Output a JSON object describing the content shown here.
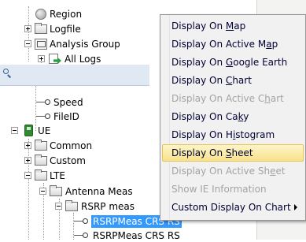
{
  "tree": {
    "region": {
      "label": "Region"
    },
    "logfile": {
      "label": "Logfile"
    },
    "analysis_group": {
      "label": "Analysis Group"
    },
    "all_logs": {
      "label": "All Logs"
    },
    "speed": {
      "label": "Speed"
    },
    "fileid": {
      "label": "FileID"
    },
    "ue": {
      "label": "UE"
    },
    "common": {
      "label": "Common"
    },
    "custom": {
      "label": "Custom"
    },
    "lte": {
      "label": "LTE"
    },
    "antenna": {
      "label": "Antenna Meas"
    },
    "rsrp": {
      "label": "RSRP meas"
    },
    "rsrp_item_1": {
      "label": "RSRPMeas CRS RS"
    },
    "rsrp_item_2": {
      "label": "RSRPMeas CRS RS"
    }
  },
  "context_menu": {
    "items": [
      {
        "pre": "Display On ",
        "key": "M",
        "post": "ap",
        "enabled": true
      },
      {
        "pre": "Display On Active M",
        "key": "a",
        "post": "p",
        "enabled": true
      },
      {
        "pre": "Display On ",
        "key": "G",
        "post": "oogle Earth",
        "enabled": true
      },
      {
        "pre": "Display On ",
        "key": "C",
        "post": "hart",
        "enabled": true
      },
      {
        "pre": "Display On Active C",
        "key": "h",
        "post": "art",
        "enabled": false
      },
      {
        "pre": "Display On Ca",
        "key": "k",
        "post": "y",
        "enabled": true
      },
      {
        "pre": "Display On H",
        "key": "i",
        "post": "stogram",
        "enabled": true
      },
      {
        "pre": "Display On ",
        "key": "S",
        "post": "heet",
        "enabled": true,
        "highlighted": true
      },
      {
        "pre": "Display On Active Sh",
        "key": "e",
        "post": "et",
        "enabled": false
      },
      {
        "pre": "Show IE Information",
        "key": "",
        "post": "",
        "enabled": false
      },
      {
        "pre": "Custom Display On Chart",
        "key": "",
        "post": "",
        "enabled": true,
        "submenu": true
      }
    ]
  }
}
